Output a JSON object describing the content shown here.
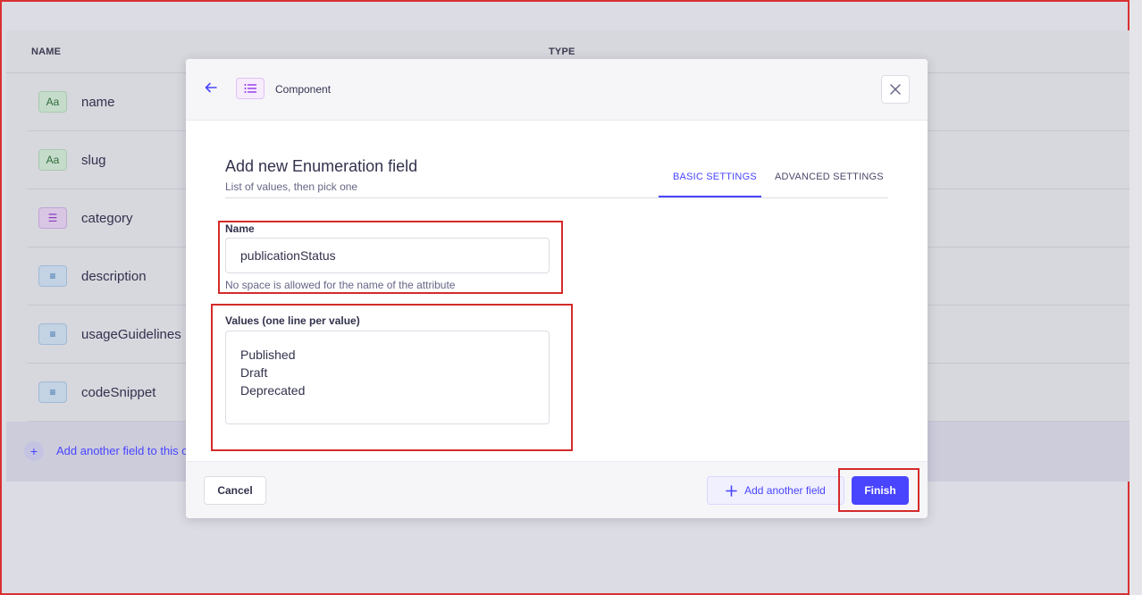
{
  "background": {
    "columns": {
      "name": "NAME",
      "type": "TYPE"
    },
    "fields": [
      {
        "name": "name",
        "icon": "text-icon",
        "glyph": "Aa"
      },
      {
        "name": "slug",
        "icon": "text-icon",
        "glyph": "Aa"
      },
      {
        "name": "category",
        "icon": "enumeration-icon",
        "glyph": "☰"
      },
      {
        "name": "description",
        "icon": "rich-text-icon",
        "glyph": "≡"
      },
      {
        "name": "usageGuidelines",
        "icon": "rich-text-icon",
        "glyph": "≡"
      },
      {
        "name": "codeSnippet",
        "icon": "rich-text-icon",
        "glyph": "≡"
      }
    ],
    "add_field_label": "Add another field to this co"
  },
  "modal": {
    "breadcrumb": "Component",
    "title": "Add new Enumeration field",
    "subtitle": "List of values, then pick one",
    "tabs": [
      {
        "label": "BASIC SETTINGS",
        "active": true
      },
      {
        "label": "ADVANCED SETTINGS",
        "active": false
      }
    ],
    "name_field": {
      "label": "Name",
      "value": "publicationStatus",
      "hint": "No space is allowed for the name of the attribute"
    },
    "values_field": {
      "label": "Values (one line per value)",
      "lines": [
        "Published",
        "Draft",
        "Deprecated"
      ]
    },
    "footer": {
      "cancel_label": "Cancel",
      "add_another_label": "Add another field",
      "finish_label": "Finish"
    }
  },
  "colors": {
    "primary": "#4945ff",
    "highlight": "#d42b2b"
  }
}
